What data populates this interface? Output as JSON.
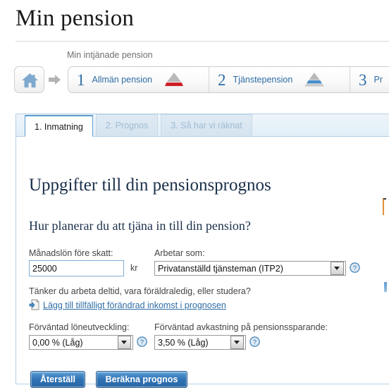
{
  "page": {
    "title": "Min pension"
  },
  "breadcrumb": {
    "caption": "Min intjänade pension",
    "home_icon": "home-icon",
    "arrow_icon": "arrow-right-icon",
    "steps": [
      {
        "number": "1",
        "label": "Allmän pension",
        "icon": "triangle-red-icon"
      },
      {
        "number": "2",
        "label": "Tjänstepension",
        "icon": "triangle-blue-icon"
      },
      {
        "number": "3",
        "label": "Pr",
        "icon": ""
      }
    ]
  },
  "tabs": [
    {
      "label": "1. Inmatning",
      "active": true
    },
    {
      "label": "2. Prognos",
      "active": false
    },
    {
      "label": "3. Så har vi räknat",
      "active": false
    }
  ],
  "form": {
    "heading": "Uppgifter till din pensionsprognos",
    "subheading": "Hur planerar du att tjäna in till din pension?",
    "salary": {
      "label": "Månadslön före skatt:",
      "value": "25000",
      "placeholder": "",
      "unit": "kr"
    },
    "occupation": {
      "label": "Arbetar som:",
      "value": "Privatanställd tjänsteman (ITP2)",
      "help_icon": "help-icon"
    },
    "question": "Tänker du arbeta deltid, vara föräldraledig, eller studera?",
    "add_link": {
      "label": "Lägg till tillfälligt förändrad inkomst i prognosen",
      "icon": "add-document-icon"
    },
    "salary_growth": {
      "label": "Förväntad löneutveckling:",
      "value": "0,00 % (Låg)",
      "help_icon": "help-icon"
    },
    "return_rate": {
      "label": "Förväntad avkastning på pensionssparande:",
      "value": "3,50 % (Låg)",
      "help_icon": "help-icon"
    }
  },
  "buttons": {
    "reset": "Återställ",
    "calculate": "Beräkna prognos"
  },
  "colors": {
    "accent_blue": "#2e6ca4",
    "button_blue": "#2f72b4",
    "panel_border": "#b6cfe2",
    "triangle_red": "#cf2027",
    "triangle_blue": "#4a8ec8"
  }
}
